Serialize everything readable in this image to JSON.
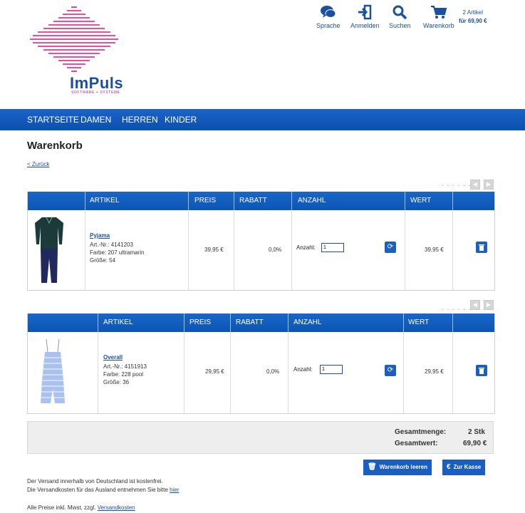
{
  "header": {
    "logo_text": "ImPuls",
    "logo_sub": "SOFTWARE + SYSTEME",
    "items": [
      {
        "label": "Sprache",
        "icon": "chat-bubbles-icon"
      },
      {
        "label": "Anmelden",
        "icon": "login-icon"
      },
      {
        "label": "Suchen",
        "icon": "search-icon"
      },
      {
        "label": "Warenkorb",
        "icon": "cart-icon"
      }
    ],
    "cart_count": "2 Artikel",
    "cart_total": "für 69,90 €"
  },
  "nav": [
    "STARTSEITE",
    "DAMEN",
    "HERREN",
    "KINDER"
  ],
  "page": {
    "title": "Warenkorb",
    "back": "< Zurück"
  },
  "pager": {
    "dots": ". . . . . . .",
    "prev": "◀",
    "next": "▶"
  },
  "columns": [
    "ARTIKEL",
    "PREIS",
    "RABATT",
    "ANZAHL",
    "WERT"
  ],
  "items": [
    {
      "name": "Pyjama",
      "art_nr": "Art.-Nr.: 4141203",
      "farbe": "Farbe: 207  ultramarin",
      "groesse": "Größe: 54",
      "preis": "39,95 €",
      "rabatt": "0,0%",
      "anzahl_label": "Anzahl:",
      "anzahl": "1",
      "wert": "39,95 €"
    },
    {
      "name": "Overall",
      "art_nr": "Art.-Nr.: 4151913",
      "farbe": "Farbe: 228  pool",
      "groesse": "Größe: 36",
      "preis": "29,95 €",
      "rabatt": "0,0%",
      "anzahl_label": "Anzahl:",
      "anzahl": "1",
      "wert": "29,95 €"
    }
  ],
  "totals": {
    "menge_label": "Gesamtmenge:",
    "menge": "2 Stk",
    "wert_label": "Gesamtwert:",
    "wert": "69,90 €"
  },
  "buttons": {
    "clear": "Warenkorb leeren",
    "checkout": "Zur Kasse"
  },
  "footer": {
    "line1": "Der Versand innerhalb von Deutschland ist kostenfrei.",
    "line2": "Die Versandkosten für das Ausland entnehmen Sie bitte",
    "line2_link": "hier",
    "line3": "Alle Preise inkl. Mwst, zzgl.",
    "line3_link": "Versandkosten"
  },
  "colors": {
    "primary": "#1d5fbf",
    "brand_pink": "#e0157e",
    "brand_blue": "#1d4fa1"
  }
}
